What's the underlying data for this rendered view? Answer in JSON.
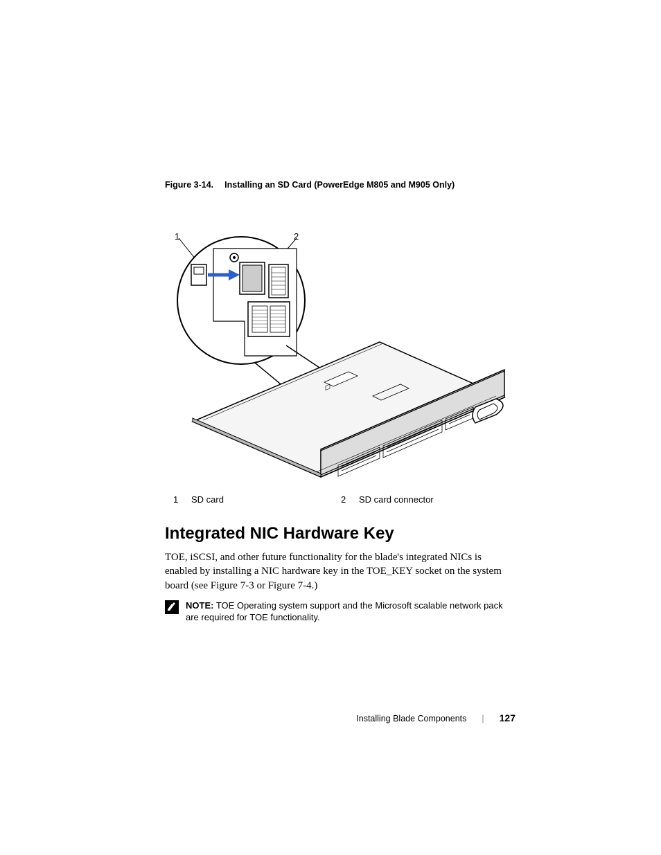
{
  "figure": {
    "label": "Figure 3-14.",
    "title": "Installing an SD Card (PowerEdge M805 and M905 Only)",
    "callouts": {
      "c1": "1",
      "c2": "2"
    },
    "legend": [
      {
        "num": "1",
        "text": "SD card"
      },
      {
        "num": "2",
        "text": "SD card connector"
      }
    ]
  },
  "section": {
    "heading": "Integrated NIC Hardware Key",
    "paragraph": "TOE, iSCSI, and other future functionality for the blade's integrated NICs is enabled by installing a NIC hardware key in the TOE_KEY socket on the system board (see Figure 7-3 or Figure 7-4.)"
  },
  "note": {
    "label": "NOTE:",
    "text": " TOE Operating system support and the Microsoft scalable network pack are required for TOE functionality."
  },
  "footer": {
    "chapter": "Installing Blade Components",
    "page": "127"
  }
}
